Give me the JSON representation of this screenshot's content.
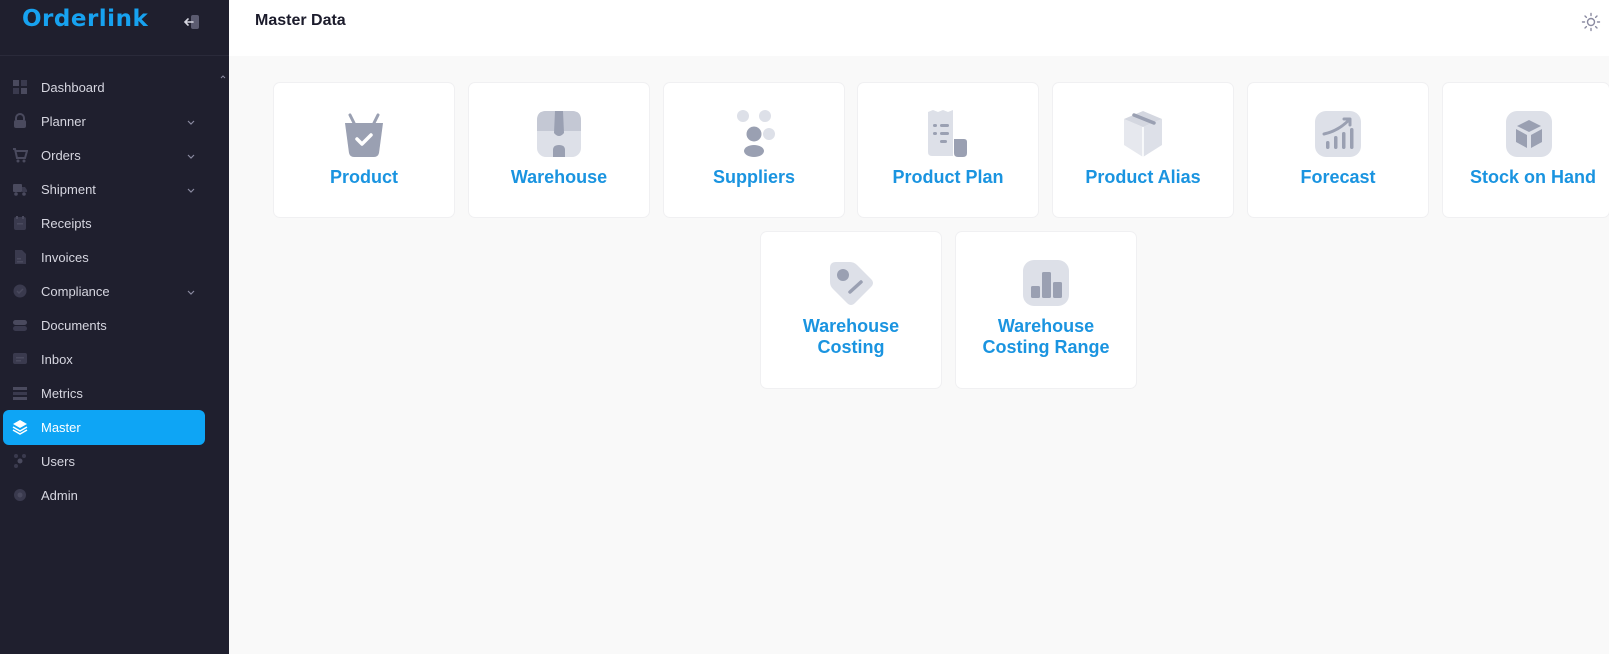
{
  "brand": {
    "name": "Orderlink",
    "color": "#17a2f0"
  },
  "sidebar": {
    "items": [
      {
        "label": "Dashboard",
        "icon": "dashboard-icon",
        "has_children": false
      },
      {
        "label": "Planner",
        "icon": "planner-icon",
        "has_children": true
      },
      {
        "label": "Orders",
        "icon": "cart-icon",
        "has_children": true
      },
      {
        "label": "Shipment",
        "icon": "truck-icon",
        "has_children": true
      },
      {
        "label": "Receipts",
        "icon": "receipt-icon",
        "has_children": false
      },
      {
        "label": "Invoices",
        "icon": "invoice-icon",
        "has_children": false
      },
      {
        "label": "Compliance",
        "icon": "shield-check-icon",
        "has_children": true
      },
      {
        "label": "Documents",
        "icon": "documents-icon",
        "has_children": false
      },
      {
        "label": "Inbox",
        "icon": "inbox-icon",
        "has_children": false
      },
      {
        "label": "Metrics",
        "icon": "metrics-icon",
        "has_children": false
      },
      {
        "label": "Master",
        "icon": "layers-icon",
        "has_children": false,
        "active": true
      },
      {
        "label": "Users",
        "icon": "users-icon",
        "has_children": false
      },
      {
        "label": "Admin",
        "icon": "gear-icon",
        "has_children": false
      }
    ],
    "active_color": "#0ea5f5"
  },
  "header": {
    "title": "Master Data",
    "theme_icon": "sun-icon"
  },
  "cards": [
    {
      "line1": "Product",
      "line2": "",
      "icon": "basket-icon"
    },
    {
      "line1": "Warehouse",
      "line2": "",
      "icon": "shop-icon"
    },
    {
      "line1": "Suppliers",
      "line2": "",
      "icon": "people-icon"
    },
    {
      "line1": "Product Plan",
      "line2": "",
      "icon": "receipt-list-icon"
    },
    {
      "line1": "Product Alias",
      "line2": "",
      "icon": "box-open-icon"
    },
    {
      "line1": "Forecast",
      "line2": "",
      "icon": "chart-up-icon"
    },
    {
      "line1": "Stock on Hand",
      "line2": "",
      "icon": "cube-icon"
    },
    {
      "line1": "Warehouse",
      "line2": "Costing",
      "icon": "tag-icon"
    },
    {
      "line1": "Warehouse",
      "line2": "Costing Range",
      "icon": "bar-chart-icon"
    }
  ],
  "colors": {
    "card_title": "#1a94e0",
    "icon_gray": "#9aa0b2"
  }
}
